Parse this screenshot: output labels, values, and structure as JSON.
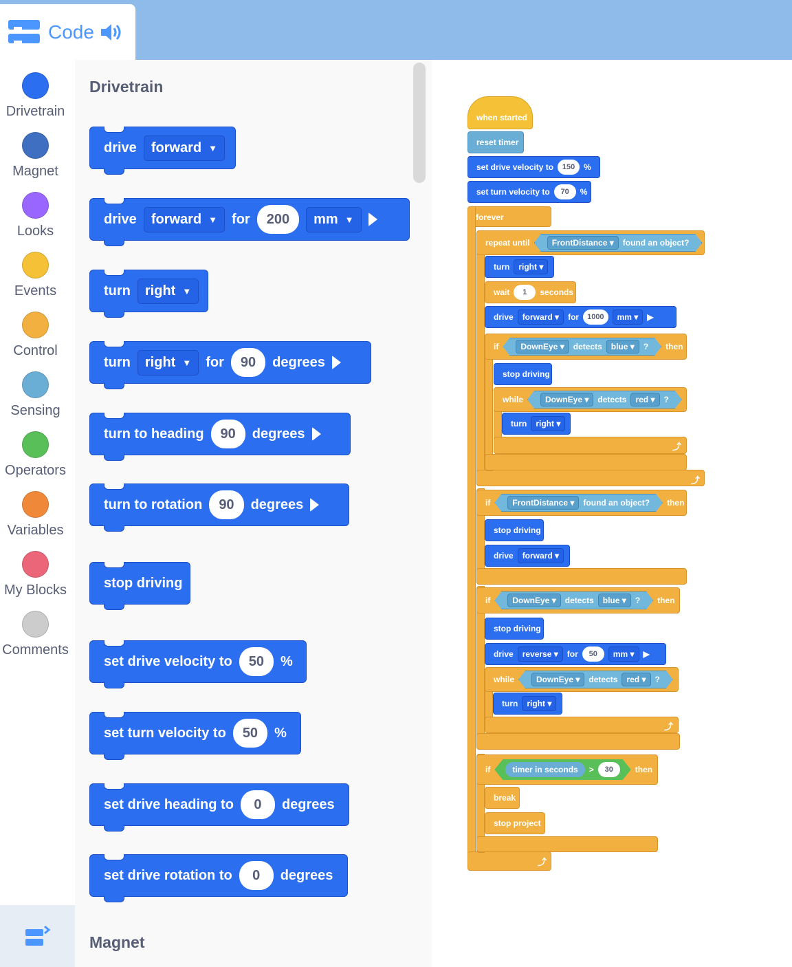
{
  "header": {
    "tab_label": "Code"
  },
  "categories": [
    {
      "label": "Drivetrain",
      "color": "#2b6ef0"
    },
    {
      "label": "Magnet",
      "color": "#3f6fc0"
    },
    {
      "label": "Looks",
      "color": "#9966ff"
    },
    {
      "label": "Events",
      "color": "#f5c237"
    },
    {
      "label": "Control",
      "color": "#f2b040"
    },
    {
      "label": "Sensing",
      "color": "#6aaed6"
    },
    {
      "label": "Operators",
      "color": "#59c059"
    },
    {
      "label": "Variables",
      "color": "#f0883a"
    },
    {
      "label": "My Blocks",
      "color": "#ea6678"
    },
    {
      "label": "Comments",
      "color": "#cccccc"
    }
  ],
  "palette": {
    "section_drivetrain": "Drivetrain",
    "section_magnet": "Magnet",
    "b1": {
      "w1": "drive",
      "dd1": "forward"
    },
    "b2": {
      "w1": "drive",
      "dd1": "forward",
      "w2": "for",
      "n1": "200",
      "dd2": "mm"
    },
    "b3": {
      "w1": "turn",
      "dd1": "right"
    },
    "b4": {
      "w1": "turn",
      "dd1": "right",
      "w2": "for",
      "n1": "90",
      "w3": "degrees"
    },
    "b5": {
      "w1": "turn to heading",
      "n1": "90",
      "w2": "degrees"
    },
    "b6": {
      "w1": "turn to rotation",
      "n1": "90",
      "w2": "degrees"
    },
    "b7": {
      "w1": "stop driving"
    },
    "b8": {
      "w1": "set drive velocity to",
      "n1": "50",
      "w2": "%"
    },
    "b9": {
      "w1": "set turn velocity to",
      "n1": "50",
      "w2": "%"
    },
    "b10": {
      "w1": "set drive heading to",
      "n1": "0",
      "w2": "degrees"
    },
    "b11": {
      "w1": "set drive rotation to",
      "n1": "0",
      "w2": "degrees"
    }
  },
  "script": {
    "when_started": "when started",
    "reset_timer": "reset timer",
    "set_drive_vel": "set drive velocity to",
    "drive_vel": "150",
    "pct": "%",
    "set_turn_vel": "set turn velocity to",
    "turn_vel": "70",
    "forever": "forever",
    "repeat_until": "repeat until",
    "front_distance": "FrontDistance",
    "found_object": "found an object?",
    "turn": "turn",
    "right": "right",
    "wait": "wait",
    "wait_val": "1",
    "seconds": "seconds",
    "drive": "drive",
    "forward": "forward",
    "for": "for",
    "dist1": "1000",
    "mm": "mm",
    "if": "if",
    "then": "then",
    "down_eye": "DownEye",
    "detects": "detects",
    "blue": "blue",
    "q": "?",
    "stop_driving": "stop driving",
    "while": "while",
    "red": "red",
    "reverse": "reverse",
    "dist2": "50",
    "timer_in_seconds": "timer in seconds",
    "gt": ">",
    "timer_val": "30",
    "break": "break",
    "stop_project": "stop project"
  }
}
